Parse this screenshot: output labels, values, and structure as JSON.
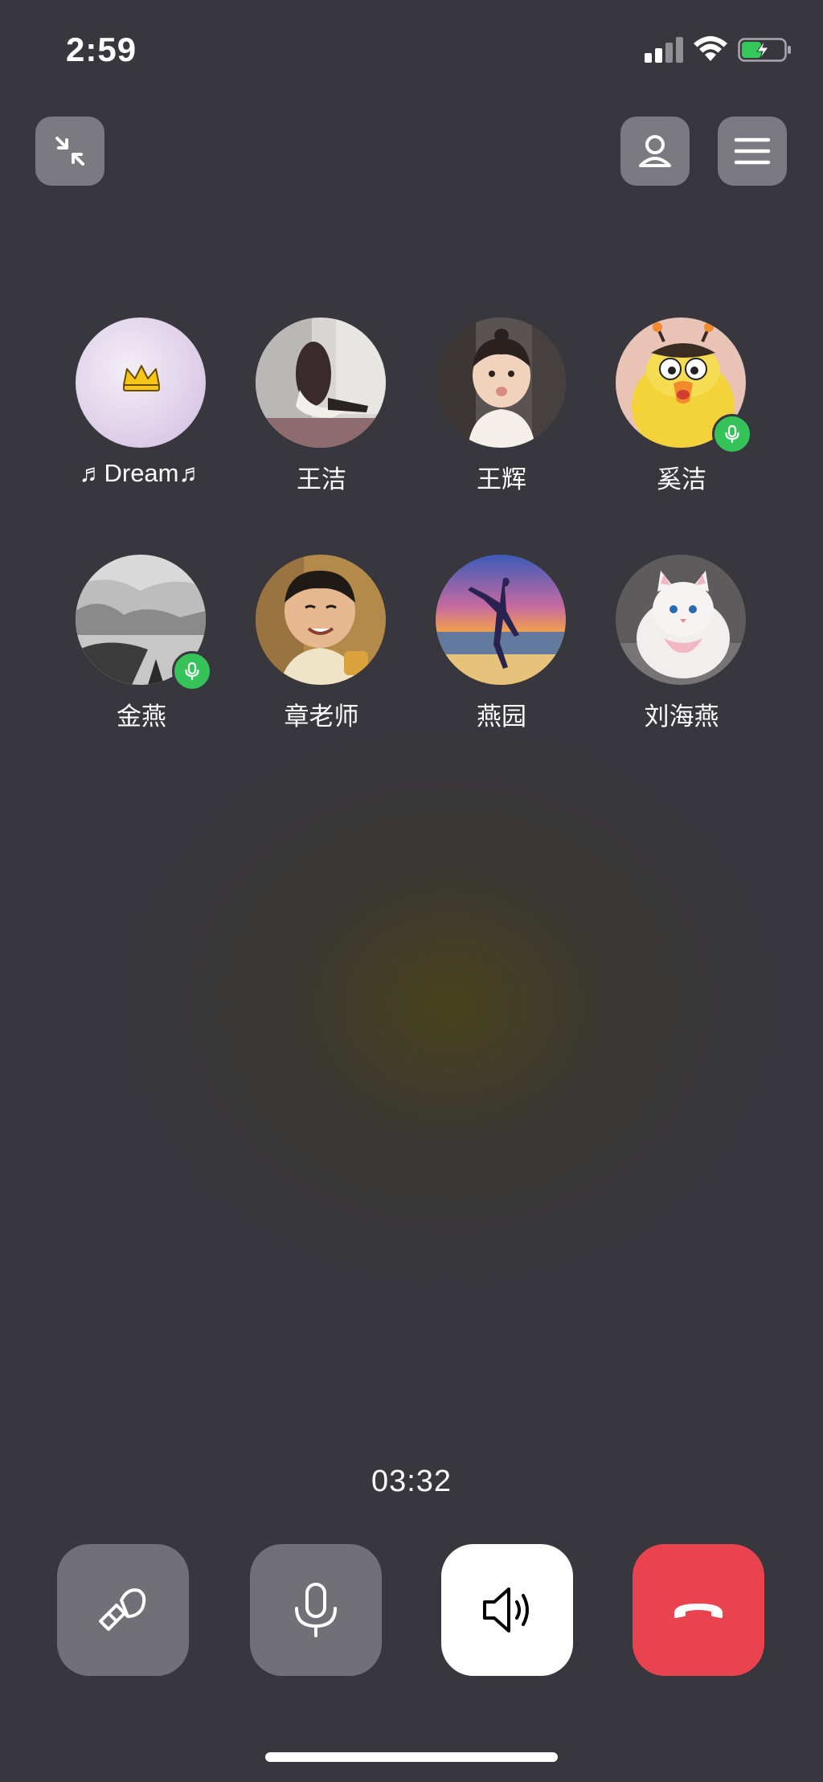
{
  "status_bar": {
    "time": "2:59",
    "icons": [
      "signal-icon",
      "wifi-icon",
      "battery-charging-icon"
    ]
  },
  "top_bar": {
    "left_button_icon": "minimize-icon",
    "right_buttons": [
      "add-person-icon",
      "menu-icon"
    ]
  },
  "participants": [
    {
      "name": "♬Dream♬",
      "avatar": "crown-avatar",
      "speaking": false
    },
    {
      "name": "王洁",
      "avatar": "woman-sitting-avatar",
      "speaking": false
    },
    {
      "name": "王辉",
      "avatar": "toddler-avatar",
      "speaking": false
    },
    {
      "name": "奚洁",
      "avatar": "cartoon-bird-avatar",
      "speaking": true
    },
    {
      "name": "金燕",
      "avatar": "misty-lake-avatar",
      "speaking": true
    },
    {
      "name": "章老师",
      "avatar": "baby-photo-avatar",
      "speaking": false
    },
    {
      "name": "燕园",
      "avatar": "dancer-sunset-avatar",
      "speaking": false
    },
    {
      "name": "刘海燕",
      "avatar": "white-cat-avatar",
      "speaking": false
    }
  ],
  "call": {
    "duration": "03:32"
  },
  "controls": [
    {
      "id": "beauty",
      "icon": "beauty-wand-icon",
      "bg": "#707076"
    },
    {
      "id": "mute",
      "icon": "microphone-icon",
      "bg": "#707076"
    },
    {
      "id": "speaker",
      "icon": "speaker-icon",
      "bg": "#ffffff"
    },
    {
      "id": "hangup",
      "icon": "hang-up-icon",
      "bg": "#e9434f"
    }
  ],
  "colors": {
    "background": "#38373d",
    "speaking_badge": "#36c35a",
    "hangup": "#e9434f"
  }
}
